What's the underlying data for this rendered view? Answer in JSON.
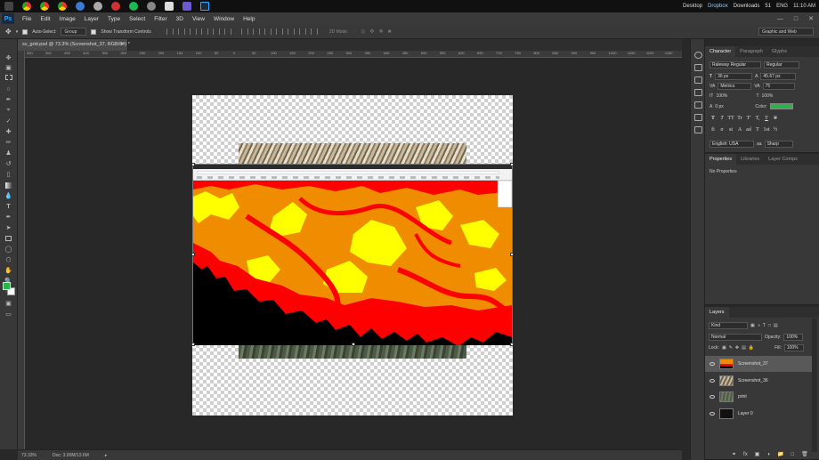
{
  "taskbar": {
    "desktop_label": "Desktop",
    "dropbox_label": "Dropbox",
    "downloads_label": "Downloads",
    "tray_count": "51",
    "language": "ENG",
    "time": "11:10 AM"
  },
  "menu": {
    "app_logo": "Ps",
    "items": [
      "File",
      "Edit",
      "Image",
      "Layer",
      "Type",
      "Select",
      "Filter",
      "3D",
      "View",
      "Window",
      "Help"
    ]
  },
  "options_bar": {
    "auto_select_label": "Auto-Select:",
    "auto_select_value": "Group",
    "transform_label": "Show Transform Controls",
    "mode_3d_label": "3D Mode:",
    "workspace": "Graphic and Web"
  },
  "document": {
    "tab_title": "sv_grid.psd @ 73.3% (Screenshot_37, RGB/8#) *",
    "zoom": "73.33%",
    "doc_size": "Doc: 3.00M/13.6M"
  },
  "ruler_ticks": [
    "550",
    "500",
    "450",
    "400",
    "350",
    "300",
    "250",
    "200",
    "150",
    "100",
    "50",
    "0",
    "50",
    "100",
    "150",
    "200",
    "250",
    "300",
    "350",
    "400",
    "450",
    "500",
    "550",
    "600",
    "650",
    "700",
    "750",
    "800",
    "850",
    "900",
    "950",
    "1000",
    "1050",
    "1100",
    "1150"
  ],
  "character_panel": {
    "tabs": [
      "Character",
      "Paragraph",
      "Glyphs"
    ],
    "font_family": "Raleway Regular",
    "font_style": "Regular",
    "font_size": "36 px",
    "leading": "45.67 px",
    "kerning": "Metrics",
    "tracking": "75",
    "vertical_scale": "100%",
    "horizontal_scale": "100%",
    "baseline": "0 px",
    "color_label": "Color:",
    "text_color": "#2db14b",
    "style_buttons": [
      "T",
      "T",
      "TT",
      "Tr",
      "T'",
      "T,",
      "T",
      "T"
    ],
    "opentype_buttons": [
      "fi",
      "σ",
      "st",
      "A",
      "ad",
      "T",
      "1st",
      "½"
    ],
    "language": "English: USA",
    "aa_prefix": "aa",
    "antialias": "Sharp"
  },
  "properties_panel": {
    "tabs": [
      "Properties",
      "Libraries",
      "Layer Comps"
    ],
    "content": "No Properties"
  },
  "layers_panel": {
    "tab": "Layers",
    "filter": "Kind",
    "blend_mode": "Normal",
    "opacity_label": "Opacity:",
    "opacity_value": "100%",
    "lock_label": "Lock:",
    "fill_label": "Fill:",
    "fill_value": "100%",
    "layers": [
      {
        "name": "Screenshot_37",
        "selected": true
      },
      {
        "name": "Screenshot_36",
        "selected": false
      },
      {
        "name": "print",
        "selected": false
      },
      {
        "name": "Layer 0",
        "selected": false
      }
    ]
  },
  "colors": {
    "ps_blue": "#31a8ff",
    "map_red": "#ff0000",
    "map_orange": "#f08c00",
    "map_yellow": "#ffff00",
    "foreground_swatch": "#2db14b",
    "background_swatch": "#ffffff"
  }
}
